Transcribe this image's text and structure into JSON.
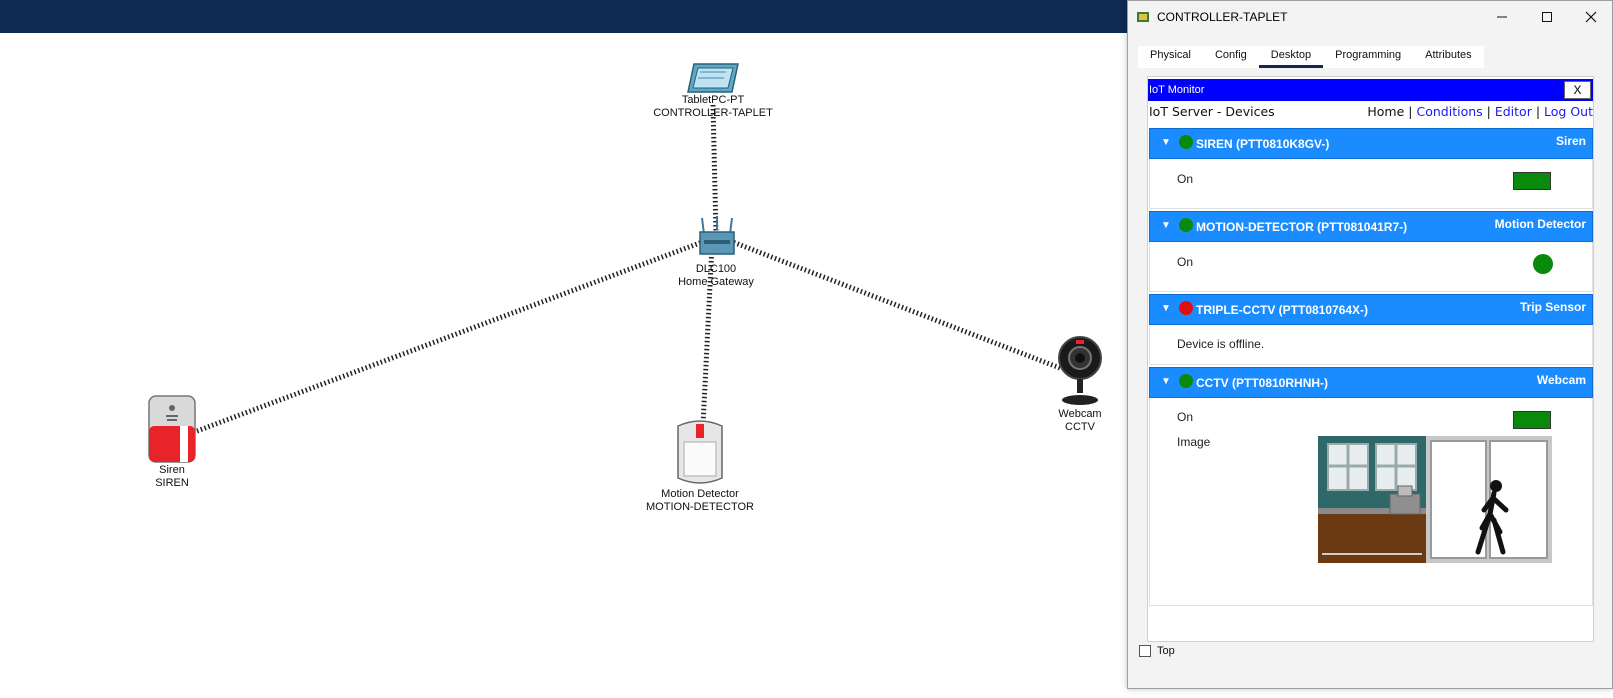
{
  "topology": {
    "tablet": {
      "line1": "TabletPC-PT",
      "line2": "CONTROLLER-TAPLET"
    },
    "gateway": {
      "line1": "DLC100",
      "line2": "Home Gateway"
    },
    "siren": {
      "line1": "Siren",
      "line2": "SIREN"
    },
    "motion": {
      "line1": "Motion Detector",
      "line2": "MOTION-DETECTOR"
    },
    "webcam": {
      "line1": "Webcam",
      "line2": "CCTV"
    }
  },
  "window": {
    "title": "CONTROLLER-TAPLET",
    "minimize_icon": "minimize-icon",
    "maximize_icon": "maximize-icon",
    "close_icon": "close-icon",
    "tabs": [
      {
        "label": "Physical"
      },
      {
        "label": "Config"
      },
      {
        "label": "Desktop",
        "active": true
      },
      {
        "label": "Programming"
      },
      {
        "label": "Attributes"
      }
    ],
    "top_checkbox_label": "Top"
  },
  "iot": {
    "header_title": "IoT Monitor",
    "close_label": "X",
    "server_title": "IoT Server - Devices",
    "nav": {
      "home": "Home",
      "sep": "|",
      "conditions": "Conditions",
      "editor": "Editor",
      "logout": "Log Out"
    },
    "devices": [
      {
        "name": "SIREN (PTT0810K8GV-)",
        "type": "Siren",
        "status_color": "#0a8a0a",
        "row_label": "On",
        "indicator": "rect"
      },
      {
        "name": "MOTION-DETECTOR (PTT081041R7-)",
        "type": "Motion Detector",
        "status_color": "#0a8a0a",
        "row_label": "On",
        "indicator": "circle"
      },
      {
        "name": "TRIPLE-CCTV (PTT0810764X-)",
        "type": "Trip Sensor",
        "status_color": "#e01010",
        "row_label": "Device is offline.",
        "indicator": "none"
      },
      {
        "name": "CCTV (PTT0810RHNH-)",
        "type": "Webcam",
        "status_color": "#0a8a0a",
        "row_label": "On",
        "indicator": "rect",
        "image_label": "Image"
      }
    ],
    "indicator_color": "#0a8a0a"
  }
}
